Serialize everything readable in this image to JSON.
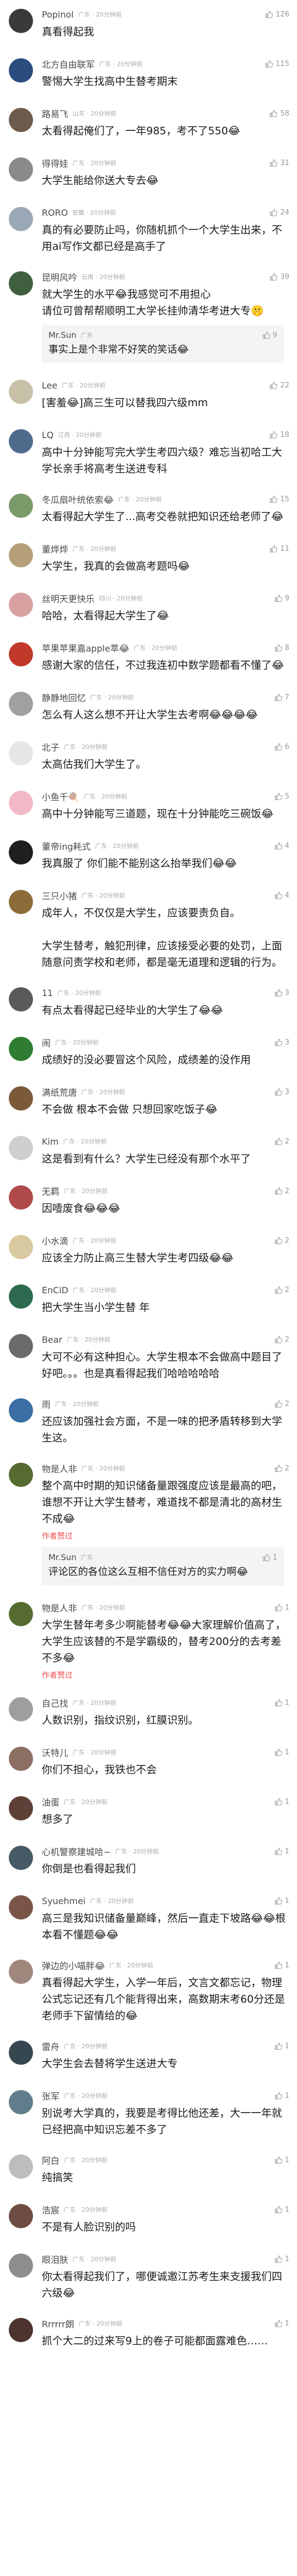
{
  "icons": {
    "like": "thumbs-up-icon"
  },
  "colors": {
    "badge": "#f04b4b",
    "name": "#4a4a4a",
    "meta": "#aaaaaa"
  },
  "comments": [
    {
      "name": "Popinol",
      "meta": "广东 · 20分钟前",
      "likes": "126",
      "body": "真看得起我",
      "avatar": "#3a3a3a"
    },
    {
      "name": "北方自由联军",
      "meta": "广东 · 20分钟前",
      "likes": "115",
      "body": "警惕大学生找高中生替考期末",
      "avatar": "#2b4c7e"
    },
    {
      "name": "路易飞",
      "meta": "山东 · 20分钟前",
      "likes": "58",
      "body": "太看得起俺们了，一年985，考不了550😂",
      "avatar": "#6d5a4a"
    },
    {
      "name": "得得娃",
      "meta": "广东 · 20分钟前",
      "likes": "31",
      "body": "大学生能给你送大专去😂",
      "avatar": "#8a8a8a"
    },
    {
      "name": "RORO",
      "meta": "安徽 · 20分钟前",
      "likes": "24",
      "body": "真的有必要防止吗，你随机抓个一个大学生出来，不用ai写作文都已经是高手了",
      "avatar": "#9aa7b5"
    },
    {
      "name": "昆明风吟",
      "meta": "云南 · 20分钟前",
      "likes": "39",
      "body": "就大学生的水平😂我感觉可不用担心\n请位可曾帮帮顺明工大学长挂帅清华考进大专🤫",
      "avatar": "#3f5f3f",
      "reply": {
        "name": "Mr.Sun",
        "meta": "广东",
        "likes": "9",
        "body": "事实上是个非常不好笑的笑话😂"
      }
    },
    {
      "name": "Lee",
      "meta": "广东 · 20分钟前",
      "likes": "22",
      "body": "[害羞😂]高三生可以替我四六级mm",
      "avatar": "#c9c0a8"
    },
    {
      "name": "LQ",
      "meta": "江西 · 20分钟前",
      "likes": "18",
      "body": "高中十分钟能写完大学生考四六级？难忘当初哈工大学长亲手将高考生送进专科",
      "avatar": "#4e6b8c"
    },
    {
      "name": "冬瓜扇叶统依索😂",
      "meta": "广东 · 20分钟前",
      "likes": "15",
      "body": "太看得起大学生了...高考交卷就把知识还给老师了😂",
      "avatar": "#7a9a6a"
    },
    {
      "name": "董烨烨",
      "meta": "广东 · 20分钟前",
      "likes": "11",
      "body": "大学生，我真的会做高考题吗😂",
      "avatar": "#b5a07a"
    },
    {
      "name": "丝明天更快乐",
      "meta": "四川 · 20分钟前",
      "likes": "9",
      "body": "哈哈，太看得起大学生了😂",
      "avatar": "#d8a0a0"
    },
    {
      "name": "苹果苹果嘉apple萃😂",
      "meta": "广东 · 20分钟前",
      "likes": "8",
      "body": "感谢大家的信任，不过我连初中数学题都看不懂了😂",
      "avatar": "#c0392b"
    },
    {
      "name": "静静地回忆",
      "meta": "广东 · 20分钟前",
      "likes": "7",
      "body": "怎么有人这么想不开让大学生去考啊😂😂😂😂",
      "avatar": "#a0a0a0"
    },
    {
      "name": "北子",
      "meta": "广东 · 20分钟前",
      "likes": "6",
      "body": "太高估我们大学生了。",
      "avatar": "#e6e6e6"
    },
    {
      "name": "小鱼千🍭",
      "meta": "广东 · 20分钟前",
      "likes": "5",
      "body": "高中十分钟能写三道题，现在十分钟能吃三碗饭😂",
      "avatar": "#f2b8c6"
    },
    {
      "name": "董帝ing耗式",
      "meta": "广东 · 20分钟前",
      "likes": "4",
      "body": "我真服了 你们能不能别这么抬举我们😂😂",
      "avatar": "#1f1f1f"
    },
    {
      "name": "三只小猪",
      "meta": "广东 · 20分钟前",
      "likes": "4",
      "body": "成年人，不仅仅是大学生，应该要责负自。\n\n大学生替考，触犯刑律，应该接受必要的处罚，上面随意问责学校和老师，都是毫无道理和逻辑的行为。",
      "avatar": "#8c6d3a"
    },
    {
      "name": "11",
      "meta": "广东 · 20分钟前",
      "likes": "3",
      "body": "有点太看得起已经毕业的大学生了😂😂",
      "avatar": "#5a5a5a"
    },
    {
      "name": "闹",
      "meta": "广东 · 20分钟前",
      "likes": "3",
      "body": "成绩好的没必要冒这个风险，成绩差的没作用",
      "avatar": "#2e7d32"
    },
    {
      "name": "满纸荒唐",
      "meta": "广东 · 20分钟前",
      "likes": "3",
      "body": "不会做 根本不会做 只想回家吃饭子😂",
      "avatar": "#7b5a3a"
    },
    {
      "name": "Kim",
      "meta": "广东 · 20分钟前",
      "likes": "2",
      "body": "这是看到有什么？大学生已经没有那个水平了",
      "avatar": "#cfcfcf"
    },
    {
      "name": "无羁",
      "meta": "广东 · 20分钟前",
      "likes": "2",
      "body": "因噎废食😂😂😂",
      "avatar": "#b04a4a"
    },
    {
      "name": "小水滴",
      "meta": "广东 · 20分钟前",
      "likes": "2",
      "body": "应该全力防止高三生替大学生考四级😂😂",
      "avatar": "#d9c9a0"
    },
    {
      "name": "EnCiD",
      "meta": "广东 · 20分钟前",
      "likes": "2",
      "body": "把大学生当小学生替 年",
      "avatar": "#2d6a4f"
    },
    {
      "name": "Bear",
      "meta": "广东 · 20分钟前",
      "likes": "2",
      "body": "大可不必有这种担心。大学生根本不会做高中题目了好吧。。。也是真看得起我们哈哈哈哈哈",
      "avatar": "#6b6b6b"
    },
    {
      "name": "雨",
      "meta": "广东 · 20分钟前",
      "likes": "2",
      "body": "还应该加强社会方面，不是一味的把矛盾转移到大学生这。",
      "avatar": "#3a6ea5"
    },
    {
      "name": "物是人非",
      "meta": "广东 · 20分钟前",
      "likes": "2",
      "body": "整个高中时期的知识储备量跟强度应该是最高的吧，谁想不开让大学生替考，难道找不都是清北的高材生不成😂",
      "avatar": "#556b2f",
      "author": "作者赞过",
      "reply": {
        "name": "Mr.Sun",
        "meta": "广东",
        "likes": "1",
        "body": "评论区的各位这么互相不信任对方的实力啊😂"
      }
    },
    {
      "name": "物是人非",
      "meta": "广东 · 20分钟前",
      "likes": "1",
      "body": "大学生替年考多少啊能替考😂😂大家理解价值高了，大学生应该替的不是学霸级的，替考200分的去考差不多😂",
      "avatar": "#556b2f",
      "author": "作者赞过"
    },
    {
      "name": "自己找",
      "meta": "广东 · 20分钟前",
      "likes": "1",
      "body": "人数识别，指纹识别，红膜识别。",
      "avatar": "#9e9e9e"
    },
    {
      "name": "沃特儿",
      "meta": "广东 · 20分钟前",
      "likes": "1",
      "body": "你们不担心，我铁也不会",
      "avatar": "#8d6e63"
    },
    {
      "name": "油蛋",
      "meta": "广东 · 20分钟前",
      "likes": "1",
      "body": "想多了",
      "avatar": "#5d4037"
    },
    {
      "name": "心机警察建城哈~",
      "meta": "广东 · 20分钟前",
      "likes": "1",
      "body": "你倒是也看得起我们",
      "avatar": "#455a64"
    },
    {
      "name": "Syuehmei",
      "meta": "广东 · 20分钟前",
      "likes": "1",
      "body": "高三是我知识储备量巅峰，然后一直走下坡路😂😂根本看不懂题😂😂",
      "avatar": "#795548"
    },
    {
      "name": "弹边的小喵胖😂",
      "meta": "广东 · 20分钟前",
      "likes": "1",
      "body": "真看得起大学生，入学一年后，文言文都忘记，物理公式忘记还有几个能背得出来，高数期末考60分还是老师手下留情给的😂",
      "avatar": "#a1887f"
    },
    {
      "name": "雷舟",
      "meta": "广东 · 20分钟前",
      "likes": "1",
      "body": "大学生会去替将学生送进大专",
      "avatar": "#37474f"
    },
    {
      "name": "张军",
      "meta": "广东 · 20分钟前",
      "likes": "1",
      "body": "别说考大学真的，我要是考得比他还差，大一一年就已经把高中知识忘差不多了",
      "avatar": "#607d8b"
    },
    {
      "name": "阿白",
      "meta": "广东 · 20分钟前",
      "likes": "1",
      "body": "纯搞笑",
      "avatar": "#bdbdbd"
    },
    {
      "name": "浩宸",
      "meta": "广东 · 20分钟前",
      "likes": "1",
      "body": "不是有人脸识别的吗",
      "avatar": "#6d4c41"
    },
    {
      "name": "眼泪肤",
      "meta": "广东 · 20分钟前",
      "likes": "1",
      "body": "你太看得起我们了，哪便诚邀江苏考生来支援我们四六级😂",
      "avatar": "#8e8e8e"
    },
    {
      "name": "Rrrrrr朗",
      "meta": "广东 · 20分钟前",
      "likes": "1",
      "body": "抓个大二的过来写9上的卷子可能都面露难色……",
      "avatar": "#4e342e"
    }
  ]
}
